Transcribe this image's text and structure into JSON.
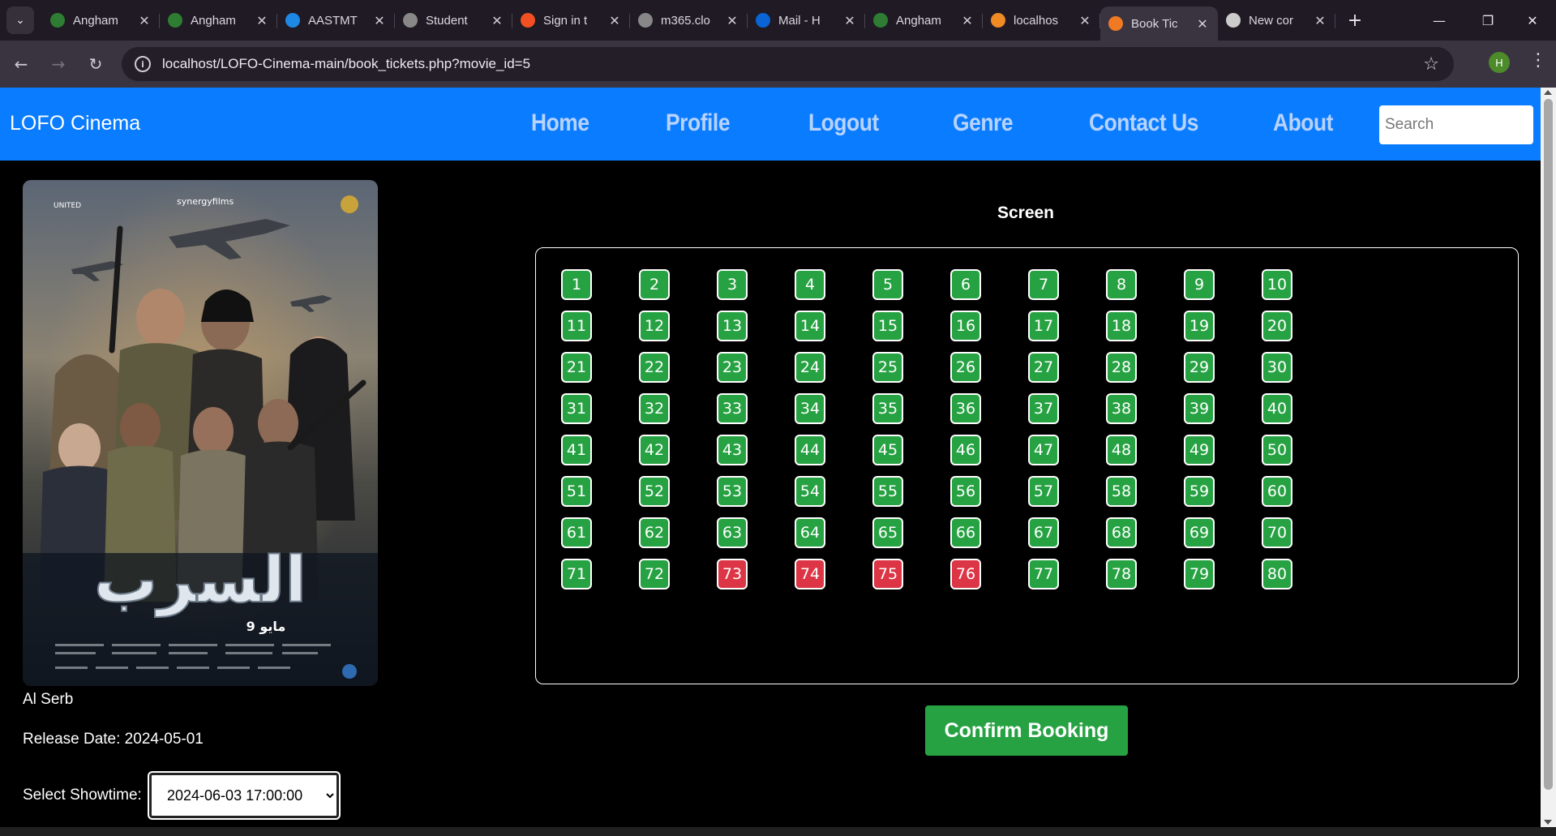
{
  "browser": {
    "tabs": [
      {
        "title": "Angham",
        "icon": "anghami-icon",
        "color": "#2e7d32"
      },
      {
        "title": "Angham",
        "icon": "anghami-icon",
        "color": "#2e7d32"
      },
      {
        "title": "AASTMT",
        "icon": "globe-icon",
        "color": "#1e88e5"
      },
      {
        "title": "Student",
        "icon": "globe-icon",
        "color": "#888888"
      },
      {
        "title": "Sign in t",
        "icon": "microsoft-icon",
        "color": "#f25022"
      },
      {
        "title": "m365.clo",
        "icon": "globe-icon",
        "color": "#888888"
      },
      {
        "title": "Mail - H",
        "icon": "outlook-icon",
        "color": "#0a64d6"
      },
      {
        "title": "Angham",
        "icon": "anghami-icon",
        "color": "#2e7d32"
      },
      {
        "title": "localhos",
        "icon": "xampp-icon",
        "color": "#f08a24"
      },
      {
        "title": "Book Tic",
        "icon": "xampp-icon",
        "color": "#f07a24",
        "active": true
      },
      {
        "title": "New cor",
        "icon": "copilot-icon",
        "color": "#cccccc"
      }
    ],
    "url": "localhost/LOFO-Cinema-main/book_tickets.php?movie_id=5",
    "profile_initial": "H"
  },
  "navbar": {
    "brand": "LOFO Cinema",
    "links": [
      "Home",
      "Profile",
      "Logout",
      "Genre",
      "Contact Us",
      "About"
    ],
    "search_placeholder": "Search",
    "color": "#0a7cff"
  },
  "movie": {
    "title": "Al Serb",
    "release_date": "Release Date: 2024-05-01",
    "poster_title_ar": "السرب",
    "poster_date_ar": "9 مايو",
    "poster_brand_left": "UNITED",
    "poster_brand_center": "synergyfilms"
  },
  "showtime": {
    "label": "Select Showtime:",
    "selected": "2024-06-03 17:00:00"
  },
  "seating": {
    "screen_label": "Screen",
    "total_seats": 80,
    "columns": 10,
    "booked": [
      73,
      74,
      75,
      76
    ],
    "available_color": "#27a243",
    "booked_color": "#dc3545"
  },
  "confirm_label": "Confirm Booking"
}
